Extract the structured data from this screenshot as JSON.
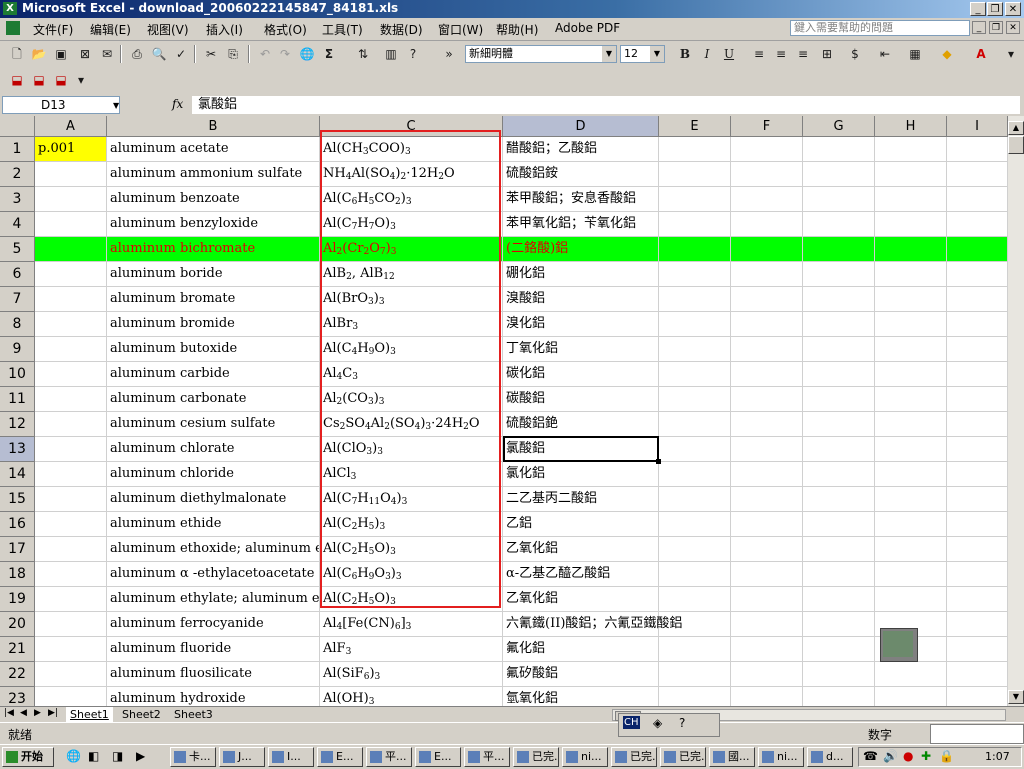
{
  "window": {
    "title": "Microsoft Excel - download_20060222145847_84181.xls",
    "app_icon": "X"
  },
  "menu": {
    "items": [
      "文件(F)",
      "编辑(E)",
      "视图(V)",
      "插入(I)",
      "格式(O)",
      "工具(T)",
      "数据(D)",
      "窗口(W)",
      "帮助(H)",
      "Adobe PDF"
    ],
    "help_placeholder": "鍵入需要幫助的問題"
  },
  "toolbar": {
    "font_name": "新細明體",
    "font_size": "12",
    "bold": "B",
    "italic": "I",
    "underline": "U",
    "sigma": "Σ"
  },
  "formula_bar": {
    "name_box": "D13",
    "fx": "fx",
    "value": "氯酸鋁"
  },
  "columns": [
    "A",
    "B",
    "C",
    "D",
    "E",
    "F",
    "G",
    "H",
    "I"
  ],
  "rows": [
    {
      "n": "1",
      "a": "p.001",
      "b": "aluminum acetate",
      "c": [
        [
          "Al(CH",
          ""
        ],
        [
          "3",
          1
        ],
        [
          "COO)",
          ""
        ],
        [
          "3",
          1
        ]
      ],
      "d": "醋酸鋁；乙酸鋁"
    },
    {
      "n": "2",
      "a": "",
      "b": "aluminum ammonium sulfate",
      "c": [
        [
          "NH",
          ""
        ],
        [
          "4",
          1
        ],
        [
          "Al(SO",
          ""
        ],
        [
          "4",
          1
        ],
        [
          ")",
          ""
        ],
        [
          "2",
          1
        ],
        [
          "·12H",
          ""
        ],
        [
          "2",
          1
        ],
        [
          "O",
          ""
        ]
      ],
      "d": "硫酸鋁銨"
    },
    {
      "n": "3",
      "a": "",
      "b": "aluminum benzoate",
      "c": [
        [
          "Al(C",
          ""
        ],
        [
          "6",
          1
        ],
        [
          "H",
          ""
        ],
        [
          "5",
          1
        ],
        [
          "CO",
          ""
        ],
        [
          "2",
          1
        ],
        [
          ")",
          ""
        ],
        [
          "3",
          1
        ]
      ],
      "d": "苯甲酸鋁；安息香酸鋁"
    },
    {
      "n": "4",
      "a": "",
      "b": "aluminum benzyloxide",
      "c": [
        [
          "Al(C",
          ""
        ],
        [
          "7",
          1
        ],
        [
          "H",
          ""
        ],
        [
          "7",
          1
        ],
        [
          "O)",
          ""
        ],
        [
          "3",
          1
        ]
      ],
      "d": "苯甲氧化鋁；苄氧化鋁"
    },
    {
      "n": "5",
      "a": "",
      "b": "aluminum bichromate",
      "c": [
        [
          "Al",
          ""
        ],
        [
          "2",
          1
        ],
        [
          "(Cr",
          ""
        ],
        [
          "2",
          1
        ],
        [
          "O",
          ""
        ],
        [
          "7",
          1
        ],
        [
          ")",
          ""
        ],
        [
          "3",
          1
        ]
      ],
      "d": "(二鉻酸)鋁",
      "highlight": true
    },
    {
      "n": "6",
      "a": "",
      "b": "aluminum boride",
      "c": [
        [
          "AlB",
          ""
        ],
        [
          "2",
          1
        ],
        [
          ", AlB",
          ""
        ],
        [
          "12",
          1
        ]
      ],
      "d": "硼化鋁"
    },
    {
      "n": "7",
      "a": "",
      "b": "aluminum bromate",
      "c": [
        [
          "Al(BrO",
          ""
        ],
        [
          "3",
          1
        ],
        [
          ")",
          ""
        ],
        [
          "3",
          1
        ]
      ],
      "d": "溴酸鋁"
    },
    {
      "n": "8",
      "a": "",
      "b": "aluminum bromide",
      "c": [
        [
          "AlBr",
          ""
        ],
        [
          "3",
          1
        ]
      ],
      "d": "溴化鋁"
    },
    {
      "n": "9",
      "a": "",
      "b": "aluminum butoxide",
      "c": [
        [
          "Al(C",
          ""
        ],
        [
          "4",
          1
        ],
        [
          "H",
          ""
        ],
        [
          "9",
          1
        ],
        [
          "O)",
          ""
        ],
        [
          "3",
          1
        ]
      ],
      "d": "丁氧化鋁"
    },
    {
      "n": "10",
      "a": "",
      "b": "aluminum carbide",
      "c": [
        [
          "Al",
          ""
        ],
        [
          "4",
          1
        ],
        [
          "C",
          ""
        ],
        [
          "3",
          1
        ]
      ],
      "d": "碳化鋁"
    },
    {
      "n": "11",
      "a": "",
      "b": "aluminum carbonate",
      "c": [
        [
          "Al",
          ""
        ],
        [
          "2",
          1
        ],
        [
          "(CO",
          ""
        ],
        [
          "3",
          1
        ],
        [
          ")",
          ""
        ],
        [
          "3",
          1
        ]
      ],
      "d": "碳酸鋁"
    },
    {
      "n": "12",
      "a": "",
      "b": "aluminum cesium sulfate",
      "c": [
        [
          "Cs",
          ""
        ],
        [
          "2",
          1
        ],
        [
          "SO",
          ""
        ],
        [
          "4",
          1
        ],
        [
          "Al",
          ""
        ],
        [
          "2",
          1
        ],
        [
          "(SO",
          ""
        ],
        [
          "4",
          1
        ],
        [
          ")",
          ""
        ],
        [
          "3",
          1
        ],
        [
          "·24H",
          ""
        ],
        [
          "2",
          1
        ],
        [
          "O",
          ""
        ]
      ],
      "d": "硫酸鋁銫"
    },
    {
      "n": "13",
      "a": "",
      "b": "aluminum chlorate",
      "c": [
        [
          "Al(ClO",
          ""
        ],
        [
          "3",
          1
        ],
        [
          ")",
          ""
        ],
        [
          "3",
          1
        ]
      ],
      "d": "氯酸鋁",
      "active": true
    },
    {
      "n": "14",
      "a": "",
      "b": "aluminum chloride",
      "c": [
        [
          "AlCl",
          ""
        ],
        [
          "3",
          1
        ]
      ],
      "d": "氯化鋁"
    },
    {
      "n": "15",
      "a": "",
      "b": "aluminum diethylmalonate",
      "c": [
        [
          "Al(C",
          ""
        ],
        [
          "7",
          1
        ],
        [
          "H",
          ""
        ],
        [
          "11",
          1
        ],
        [
          "O",
          ""
        ],
        [
          "4",
          1
        ],
        [
          ")",
          ""
        ],
        [
          "3",
          1
        ]
      ],
      "d": "二乙基丙二酸鋁"
    },
    {
      "n": "16",
      "a": "",
      "b": "aluminum ethide",
      "c": [
        [
          "Al(C",
          ""
        ],
        [
          "2",
          1
        ],
        [
          "H",
          ""
        ],
        [
          "5",
          1
        ],
        [
          ")",
          ""
        ],
        [
          "3",
          1
        ]
      ],
      "d": "乙鋁"
    },
    {
      "n": "17",
      "a": "",
      "b": "aluminum ethoxide; aluminum ethyl",
      "c": [
        [
          "Al(C",
          ""
        ],
        [
          "2",
          1
        ],
        [
          "H",
          ""
        ],
        [
          "5",
          1
        ],
        [
          "O)",
          ""
        ],
        [
          "3",
          1
        ]
      ],
      "d": "乙氧化鋁"
    },
    {
      "n": "18",
      "a": "",
      "b": "aluminum  α -ethylacetoacetate",
      "c": [
        [
          "Al(C",
          ""
        ],
        [
          "6",
          1
        ],
        [
          "H",
          ""
        ],
        [
          "9",
          1
        ],
        [
          "O",
          ""
        ],
        [
          "3",
          1
        ],
        [
          ")",
          ""
        ],
        [
          "3",
          1
        ]
      ],
      "d": "α-乙基乙醯乙酸鋁"
    },
    {
      "n": "19",
      "a": "",
      "b": "aluminum ethylate; aluminum ethox",
      "c": [
        [
          "Al(C",
          ""
        ],
        [
          "2",
          1
        ],
        [
          "H",
          ""
        ],
        [
          "5",
          1
        ],
        [
          "O)",
          ""
        ],
        [
          "3",
          1
        ]
      ],
      "d": "乙氧化鋁"
    },
    {
      "n": "20",
      "a": "",
      "b": "aluminum ferrocyanide",
      "c": [
        [
          "Al",
          ""
        ],
        [
          "4",
          1
        ],
        [
          "[Fe(CN)",
          ""
        ],
        [
          "6",
          1
        ],
        [
          "]",
          ""
        ],
        [
          "3",
          1
        ]
      ],
      "d": "六氰鐵(II)酸鋁；六氰亞鐵酸鋁"
    },
    {
      "n": "21",
      "a": "",
      "b": "aluminum fluoride",
      "c": [
        [
          "AlF",
          ""
        ],
        [
          "3",
          1
        ]
      ],
      "d": "氟化鋁"
    },
    {
      "n": "22",
      "a": "",
      "b": "aluminum fluosilicate",
      "c": [
        [
          "Al(SiF",
          ""
        ],
        [
          "6",
          1
        ],
        [
          ")",
          ""
        ],
        [
          "3",
          1
        ]
      ],
      "d": "氟矽酸鋁"
    },
    {
      "n": "23",
      "a": "",
      "b": "aluminum hydroxide",
      "c": [
        [
          "Al(OH)",
          ""
        ],
        [
          "3",
          1
        ]
      ],
      "d": "氫氧化鋁"
    }
  ],
  "sheet_tabs": [
    "Sheet1",
    "Sheet2",
    "Sheet3"
  ],
  "status": {
    "left": "就绪",
    "right": "数字"
  },
  "taskbar": {
    "start": "开始",
    "tasks": [
      "卡...",
      "J...",
      "I...",
      "E...",
      "平...",
      "E...",
      "平...",
      "已完...",
      "ni...",
      "已完...",
      "已完...",
      "國...",
      "ni...",
      "d..."
    ],
    "clock": "1:07"
  },
  "colors": {
    "highlight_row": "#00ff00",
    "highlight_text": "#e00000",
    "a1_fill": "#ffff00",
    "red_box": "#e31f1f"
  }
}
